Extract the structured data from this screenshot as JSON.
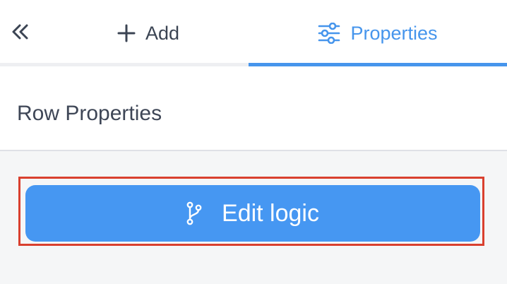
{
  "tabs": {
    "collapse_icon": "double-chevron-left-icon",
    "add": {
      "label": "Add",
      "icon": "plus-icon"
    },
    "properties": {
      "label": "Properties",
      "icon": "sliders-icon",
      "active": true
    }
  },
  "section": {
    "title": "Row Properties"
  },
  "actions": {
    "edit_logic": {
      "label": "Edit logic",
      "icon": "branch-icon"
    }
  },
  "colors": {
    "accent": "#4695ec",
    "button": "#4697f2",
    "highlight": "#d9402f",
    "text": "#3e4656"
  }
}
